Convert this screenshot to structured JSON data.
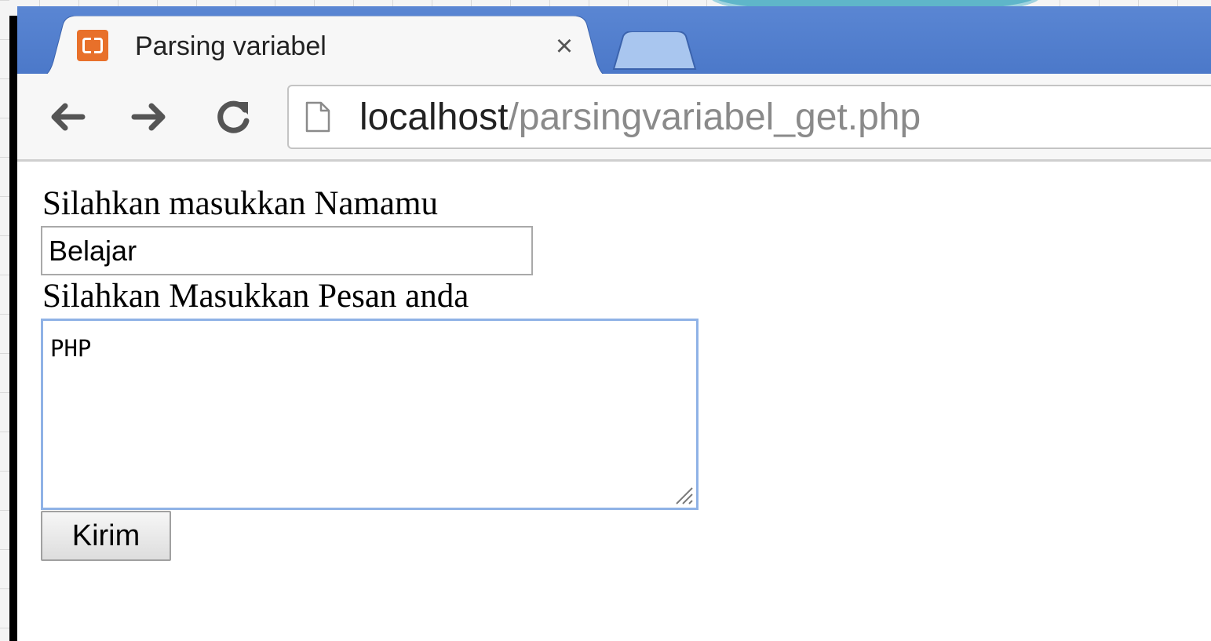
{
  "browser": {
    "tab": {
      "title": "Parsing variabel",
      "favicon": "xampp-icon",
      "close_symbol": "×"
    },
    "nav": {
      "back_icon": "arrow-left-icon",
      "forward_icon": "arrow-right-icon",
      "reload_icon": "reload-icon"
    },
    "address_bar": {
      "host": "localhost",
      "path": "/parsingvariabel_get.php"
    },
    "colors": {
      "titlebar": "#4a77c8",
      "favicon": "#e8702a"
    }
  },
  "form": {
    "name_label": "Silahkan masukkan Namamu",
    "name_value": "Belajar",
    "message_label": "Silahkan Masukkan Pesan anda",
    "message_value": "PHP",
    "submit_label": "Kirim"
  }
}
